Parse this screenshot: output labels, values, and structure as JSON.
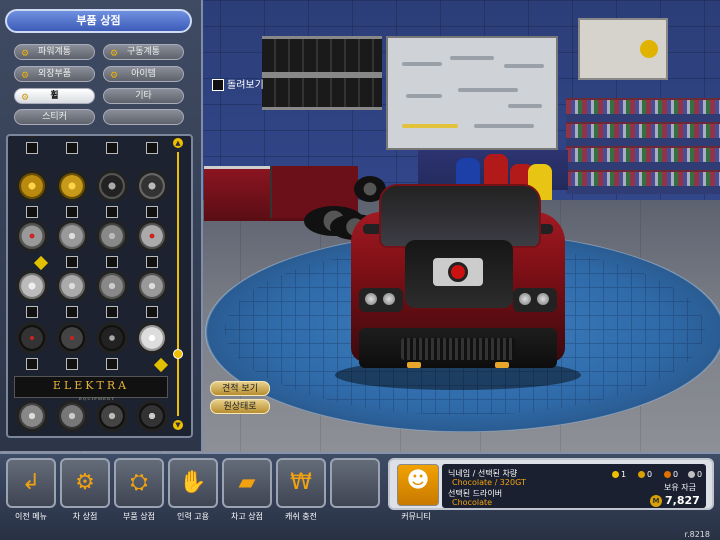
{
  "panel_title": "부품 상점",
  "categories": [
    {
      "label": "파워계통",
      "active": false
    },
    {
      "label": "구동계통",
      "active": false
    },
    {
      "label": "외장부품",
      "active": false
    },
    {
      "label": "아이템",
      "active": false
    },
    {
      "label": "휠",
      "active": true
    },
    {
      "label": "기타",
      "active": false
    },
    {
      "label": "스티커",
      "active": false
    }
  ],
  "wheel_banner": {
    "brand": "ELEKTRA",
    "sub": "EQUIPMENT"
  },
  "scene": {
    "rotate_label": "돌려보기",
    "estimate_button": "견적 보기",
    "reset_button": "원상태로"
  },
  "bottom_nav": [
    {
      "label": "이전 메뉴",
      "icon": "back-arrow-icon"
    },
    {
      "label": "차 상점",
      "icon": "car-shop-icon"
    },
    {
      "label": "부품 상점",
      "icon": "parts-shop-icon"
    },
    {
      "label": "인력 고용",
      "icon": "hire-staff-icon"
    },
    {
      "label": "차고 상점",
      "icon": "garage-shop-icon"
    },
    {
      "label": "캐쉬 충전",
      "icon": "cash-charge-icon"
    },
    {
      "label": "",
      "icon": ""
    }
  ],
  "info": {
    "community_label": "커뮤니티",
    "line1_label": "닉네임 / 선택된 차량",
    "line1_value": "Chocolate / 320GT",
    "line2_label": "선택된 드라이버",
    "line2_value": "Chocolate",
    "stats": [
      "1",
      "0",
      "0",
      "0"
    ],
    "funds_label": "보유 자금",
    "funds": "7,827"
  },
  "version": "r.8218",
  "colors": {
    "accent": "#f0c000",
    "highlight_text": "#f3a20f"
  }
}
